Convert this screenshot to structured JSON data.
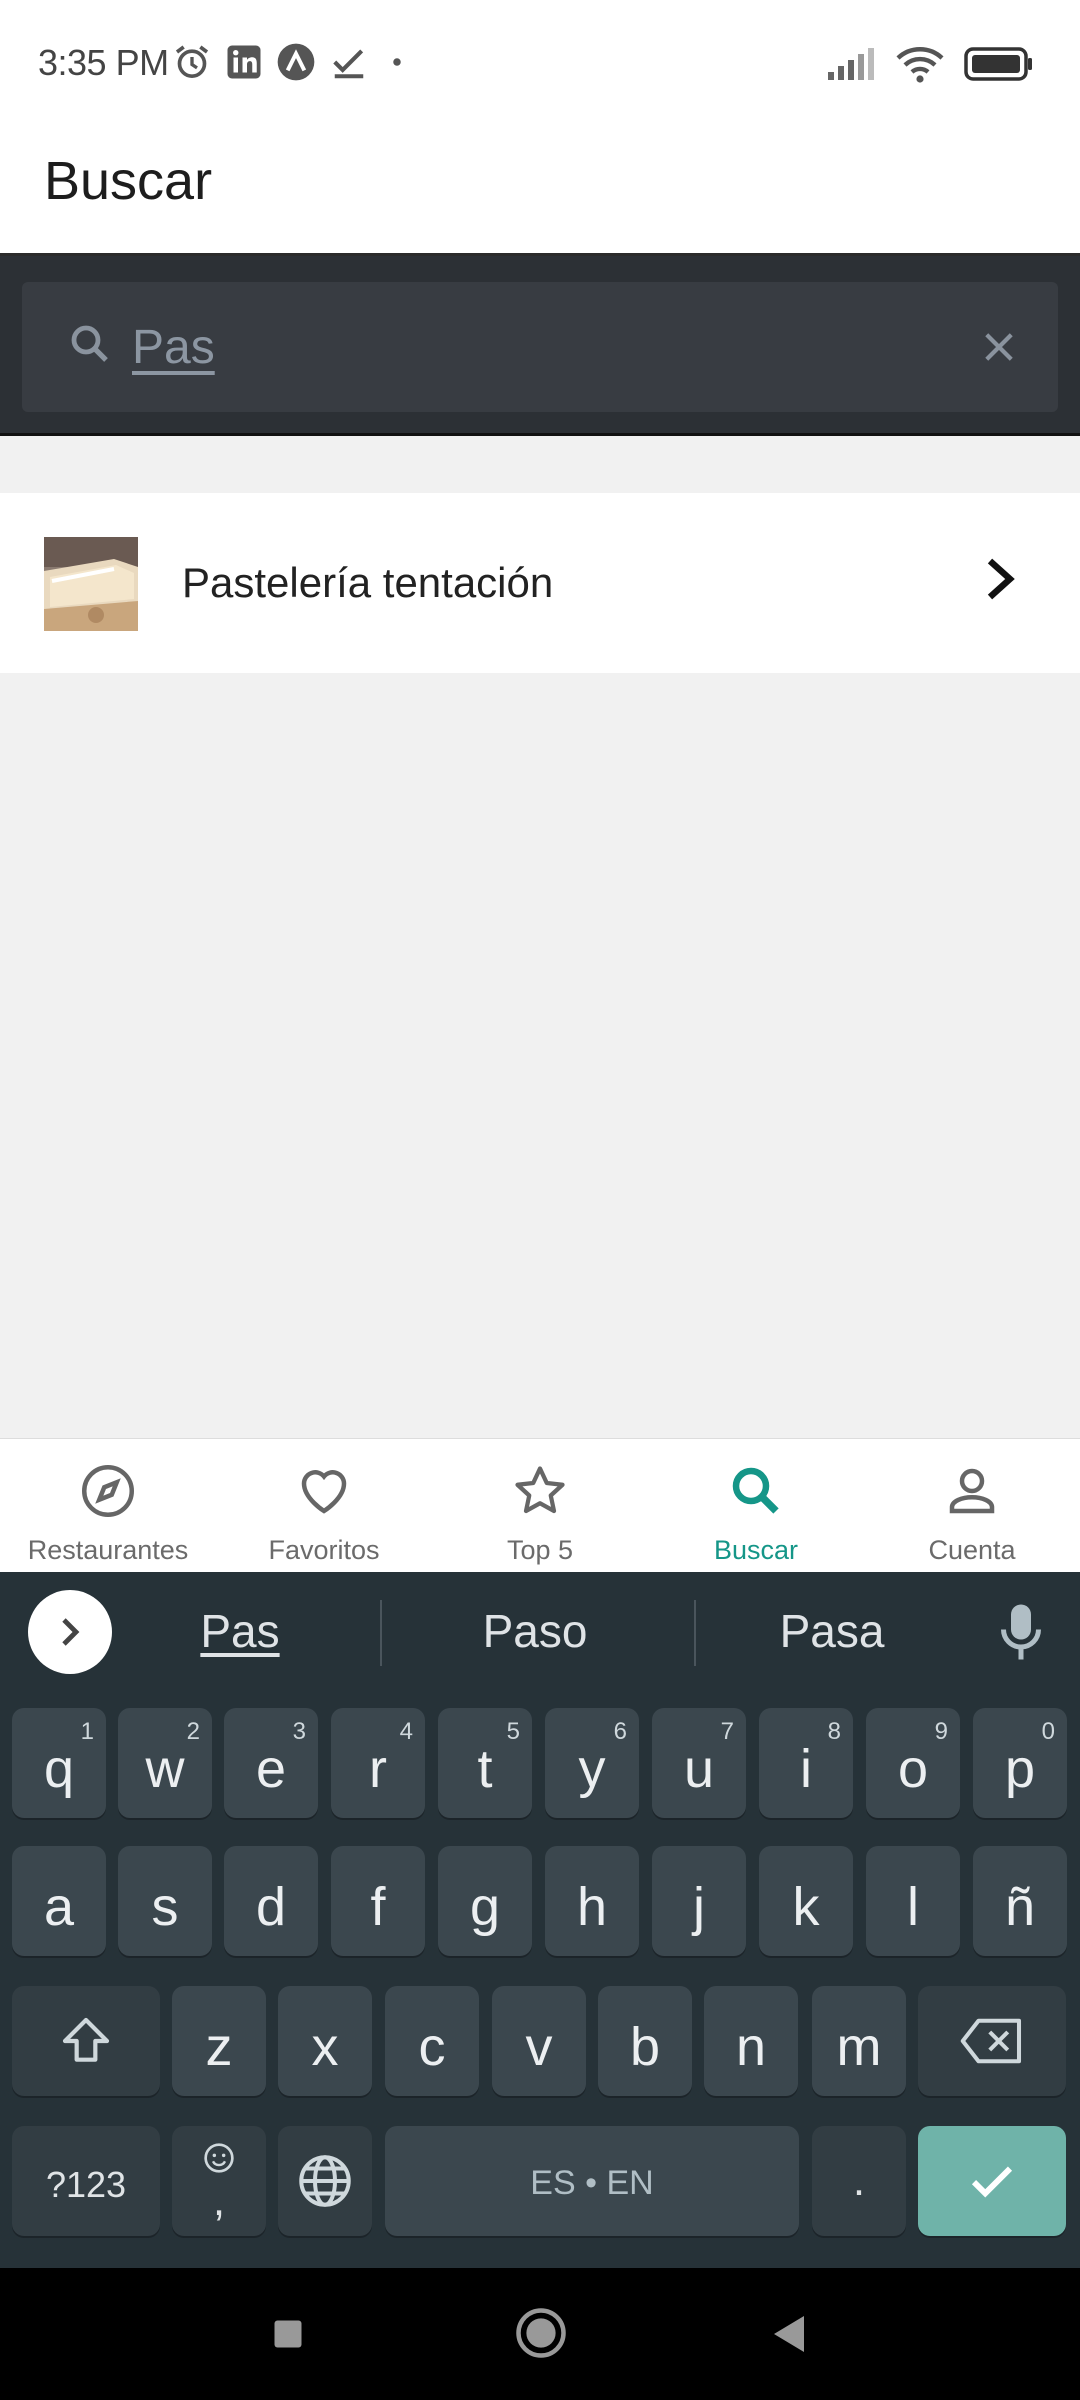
{
  "status_bar": {
    "time": "3:35 PM",
    "icons_left": [
      "alarm-icon",
      "linkedin-icon",
      "app-icon",
      "checkmark-icon",
      "dot-icon"
    ],
    "icons_right": [
      "signal-icon",
      "wifi-icon",
      "battery-icon"
    ]
  },
  "header": {
    "title": "Buscar"
  },
  "search": {
    "value": "Pas",
    "placeholder": ""
  },
  "results": [
    {
      "label": "Pastelería tentación",
      "thumbnail": "cake-slice-photo"
    }
  ],
  "bottom_nav": {
    "items": [
      {
        "label": "Restaurantes",
        "icon": "compass-icon"
      },
      {
        "label": "Favoritos",
        "icon": "heart-icon"
      },
      {
        "label": "Top 5",
        "icon": "star-icon"
      },
      {
        "label": "Buscar",
        "icon": "search-icon",
        "active": true
      },
      {
        "label": "Cuenta",
        "icon": "person-icon"
      }
    ],
    "active_color": "#159688"
  },
  "keyboard": {
    "suggestions": [
      "Pas",
      "Paso",
      "Pasa"
    ],
    "row1": [
      {
        "k": "q",
        "n": "1"
      },
      {
        "k": "w",
        "n": "2"
      },
      {
        "k": "e",
        "n": "3"
      },
      {
        "k": "r",
        "n": "4"
      },
      {
        "k": "t",
        "n": "5"
      },
      {
        "k": "y",
        "n": "6"
      },
      {
        "k": "u",
        "n": "7"
      },
      {
        "k": "i",
        "n": "8"
      },
      {
        "k": "o",
        "n": "9"
      },
      {
        "k": "p",
        "n": "0"
      }
    ],
    "row2": [
      "a",
      "s",
      "d",
      "f",
      "g",
      "h",
      "j",
      "k",
      "l",
      "ñ"
    ],
    "row3": [
      "z",
      "x",
      "c",
      "v",
      "b",
      "n",
      "m"
    ],
    "symbols_label": "?123",
    "emoji_comma": ",",
    "space_label": "ES • EN",
    "period_label": ".",
    "enter_color": "#6fb3a9"
  }
}
